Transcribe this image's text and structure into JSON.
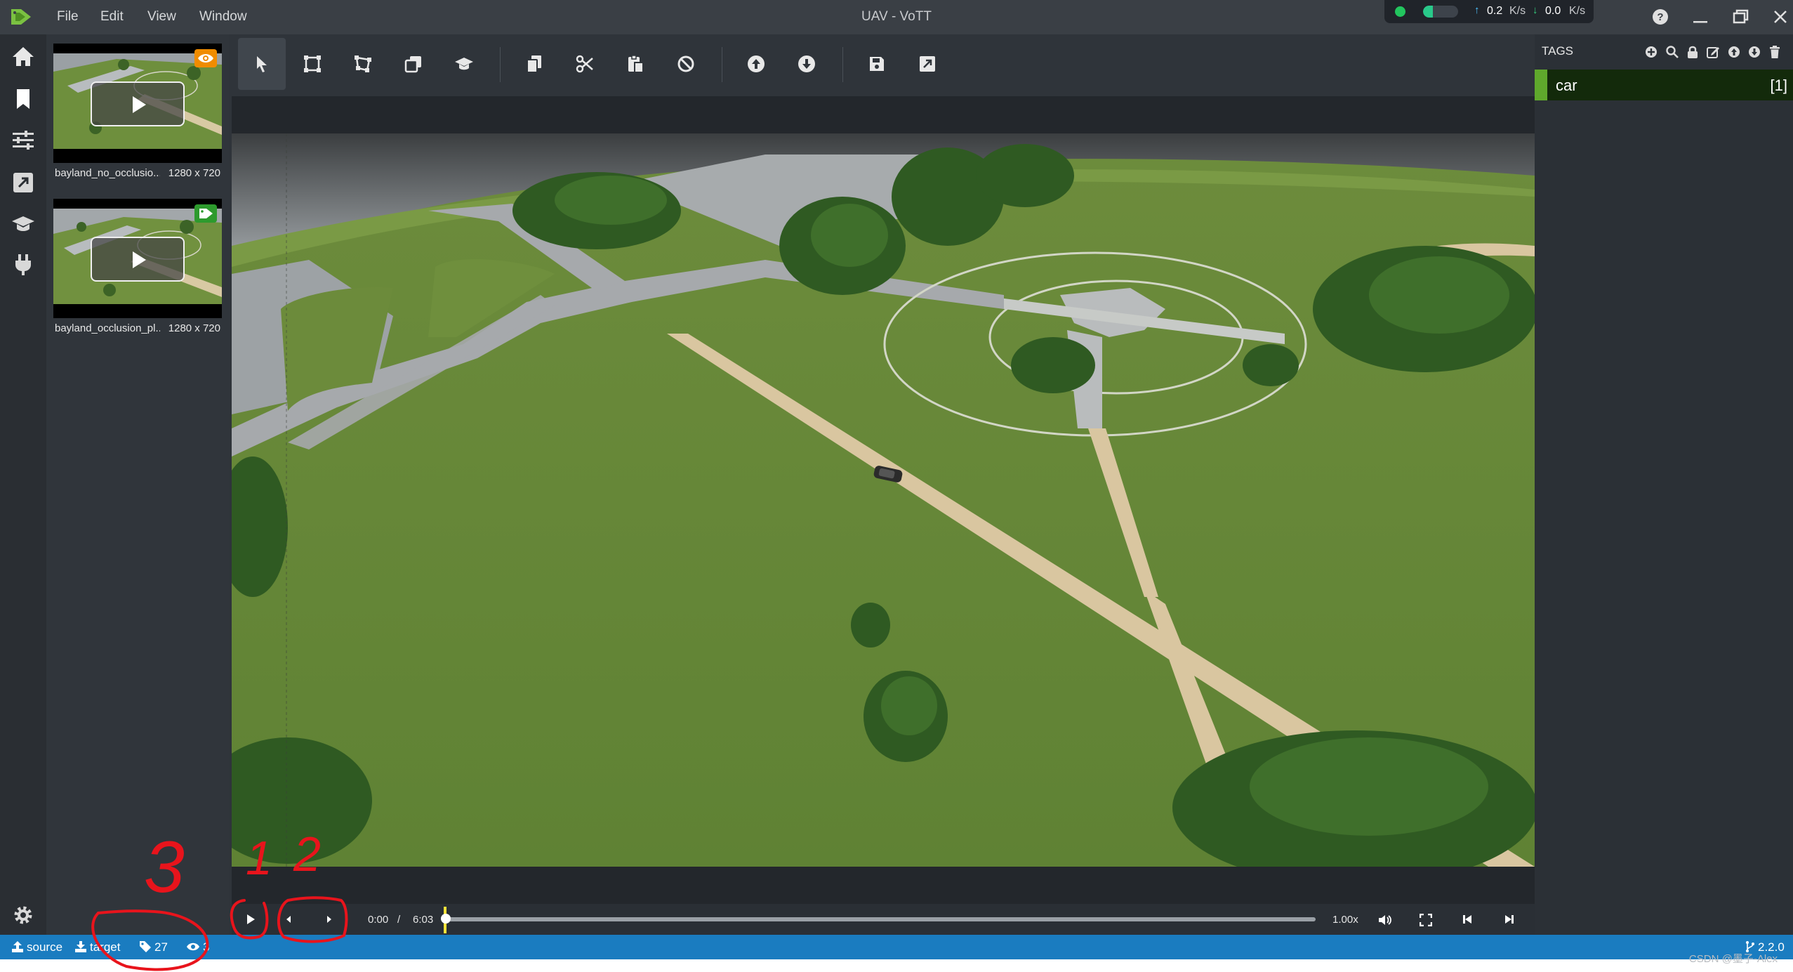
{
  "window": {
    "title": "UAV - VoTT",
    "menu": [
      "File",
      "Edit",
      "View",
      "Window"
    ]
  },
  "network": {
    "upload_value": "0.2",
    "upload_unit": "K/s",
    "download_value": "0.0",
    "download_unit": "K/s",
    "status_color": "#22c55e"
  },
  "rail_icons": [
    "home-icon",
    "bookmark-icon",
    "settings-sliders-icon",
    "export-icon",
    "graduation-cap-icon",
    "plug-icon",
    "gear-icon"
  ],
  "assets": [
    {
      "name": "bayland_no_occlusio...",
      "size": "1280 x 720",
      "badge": "eye-icon",
      "badge_color": "#f08c00"
    },
    {
      "name": "bayland_occlusion_pl...",
      "size": "1280 x 720",
      "badge": "tag-icon",
      "badge_color": "#2d9a2d"
    }
  ],
  "toolbar": {
    "tools": [
      "select-tool",
      "draw-rectangle-tool",
      "draw-polygon-tool",
      "copy-rectangle-tool",
      "active-learning-tool",
      "copy-regions-tool",
      "cut-regions-tool",
      "paste-regions-tool",
      "clear-regions-tool",
      "previous-asset-tool",
      "next-asset-tool",
      "save-project-tool",
      "export-project-tool"
    ]
  },
  "player": {
    "current_time": "0:00",
    "separator": "/",
    "total_time": "6:03",
    "progress": 0.0,
    "rate": "1.00x"
  },
  "tags": {
    "header": "TAGS",
    "items": [
      {
        "name": "car",
        "count": "[1]",
        "color": "#5fa82c"
      }
    ]
  },
  "statusbar": {
    "source": "source",
    "target": "target",
    "tag_count": "27",
    "visited_count": "3",
    "version": "2.2.0"
  },
  "watermark": "CSDN @墨子-Alex",
  "annotations": [
    "1",
    "2",
    "3"
  ],
  "accent_color": "#1a7cc0"
}
